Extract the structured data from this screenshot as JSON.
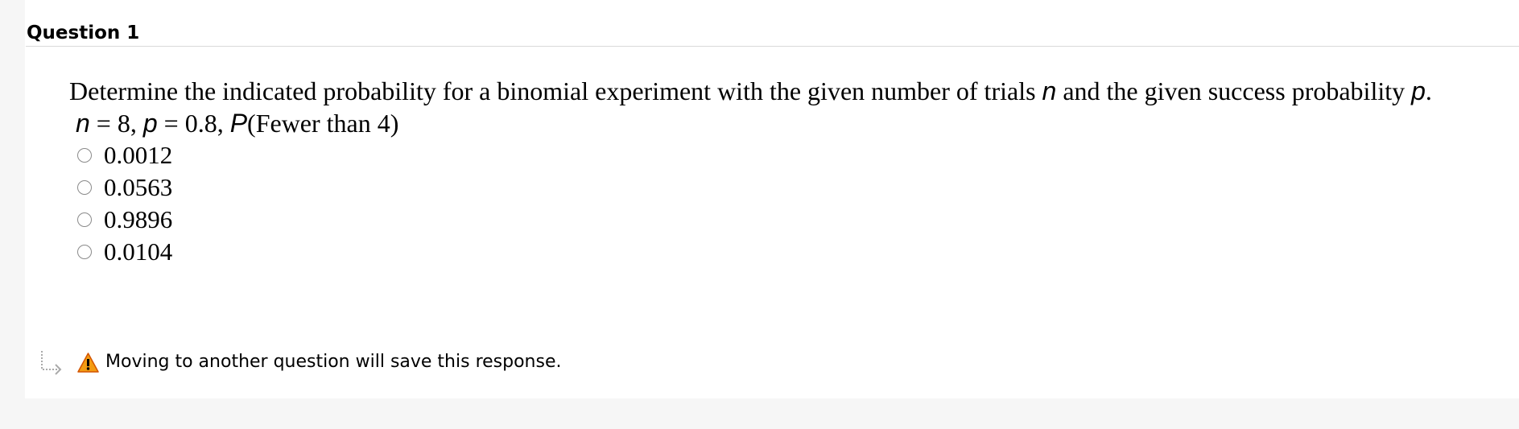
{
  "question": {
    "title": "Question 1",
    "prompt_text_1": "Determine the indicated probability for a binomial experiment with the given number of trials ",
    "prompt_var_n": "n",
    "prompt_text_2": " and the given success probability ",
    "prompt_var_p": "p",
    "prompt_text_3": ".",
    "given_n_var": "n",
    "given_n_value": " = 8, ",
    "given_p_var": "p",
    "given_p_value": " = 0.8, ",
    "given_event_var": "P",
    "given_event": "(Fewer than 4)",
    "options": [
      {
        "label": "0.0012",
        "selected": false
      },
      {
        "label": "0.0563",
        "selected": false
      },
      {
        "label": "0.9896",
        "selected": false
      },
      {
        "label": "0.0104",
        "selected": false
      }
    ]
  },
  "footer": {
    "save_note": "Moving to another question will save this response.",
    "arrow_icon": "arrow-right-icon",
    "warning_icon": "warning-icon"
  },
  "colors": {
    "page_background": "#f6f6f6",
    "card_background": "#ffffff",
    "divider": "#d9d9d9",
    "radio_border": "#8a8a8a",
    "warning_orange": "#f39c12"
  }
}
